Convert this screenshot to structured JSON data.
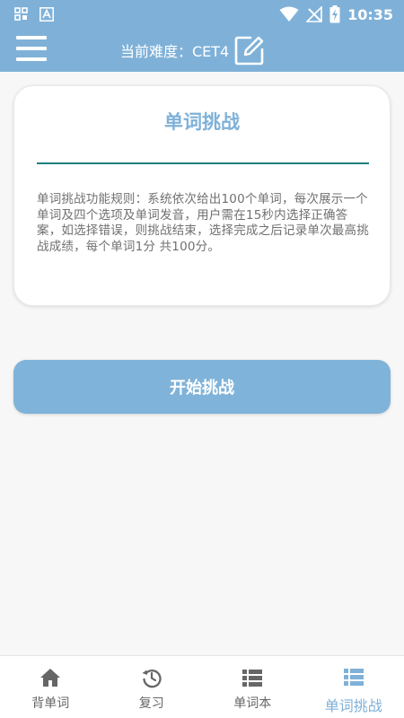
{
  "status_bar": {
    "time": "10:35",
    "left_icons": [
      "grid-app-icon",
      "text-a-icon"
    ],
    "right_icons": [
      "wifi-icon",
      "no-signal-icon",
      "battery-charging-icon"
    ]
  },
  "header": {
    "difficulty_label": "当前难度：CET4",
    "menu_icon": "hamburger-menu-icon",
    "edit_icon": "edit-square-icon"
  },
  "card": {
    "title": "单词挑战",
    "rules": "单词挑战功能规则：系统依次给出100个单词，每次展示一个单词及四个选项及单词发音，用户需在15秒内选择正确答案，如选择错误，则挑战结束，选择完成之后记录单次最高挑战成绩，每个单词1分 共100分。"
  },
  "start_button": {
    "label": "开始挑战"
  },
  "bottom_nav": {
    "items": [
      {
        "label": "背单词",
        "icon": "home-icon",
        "active": false
      },
      {
        "label": "复习",
        "icon": "history-icon",
        "active": false
      },
      {
        "label": "单词本",
        "icon": "list-icon",
        "active": false
      },
      {
        "label": "单词挑战",
        "icon": "list-icon",
        "active": true
      }
    ]
  },
  "colors": {
    "primary": "#7fb1d8",
    "underline": "#1f7f7f",
    "background": "#f7f7f7",
    "text_muted": "#707070"
  }
}
